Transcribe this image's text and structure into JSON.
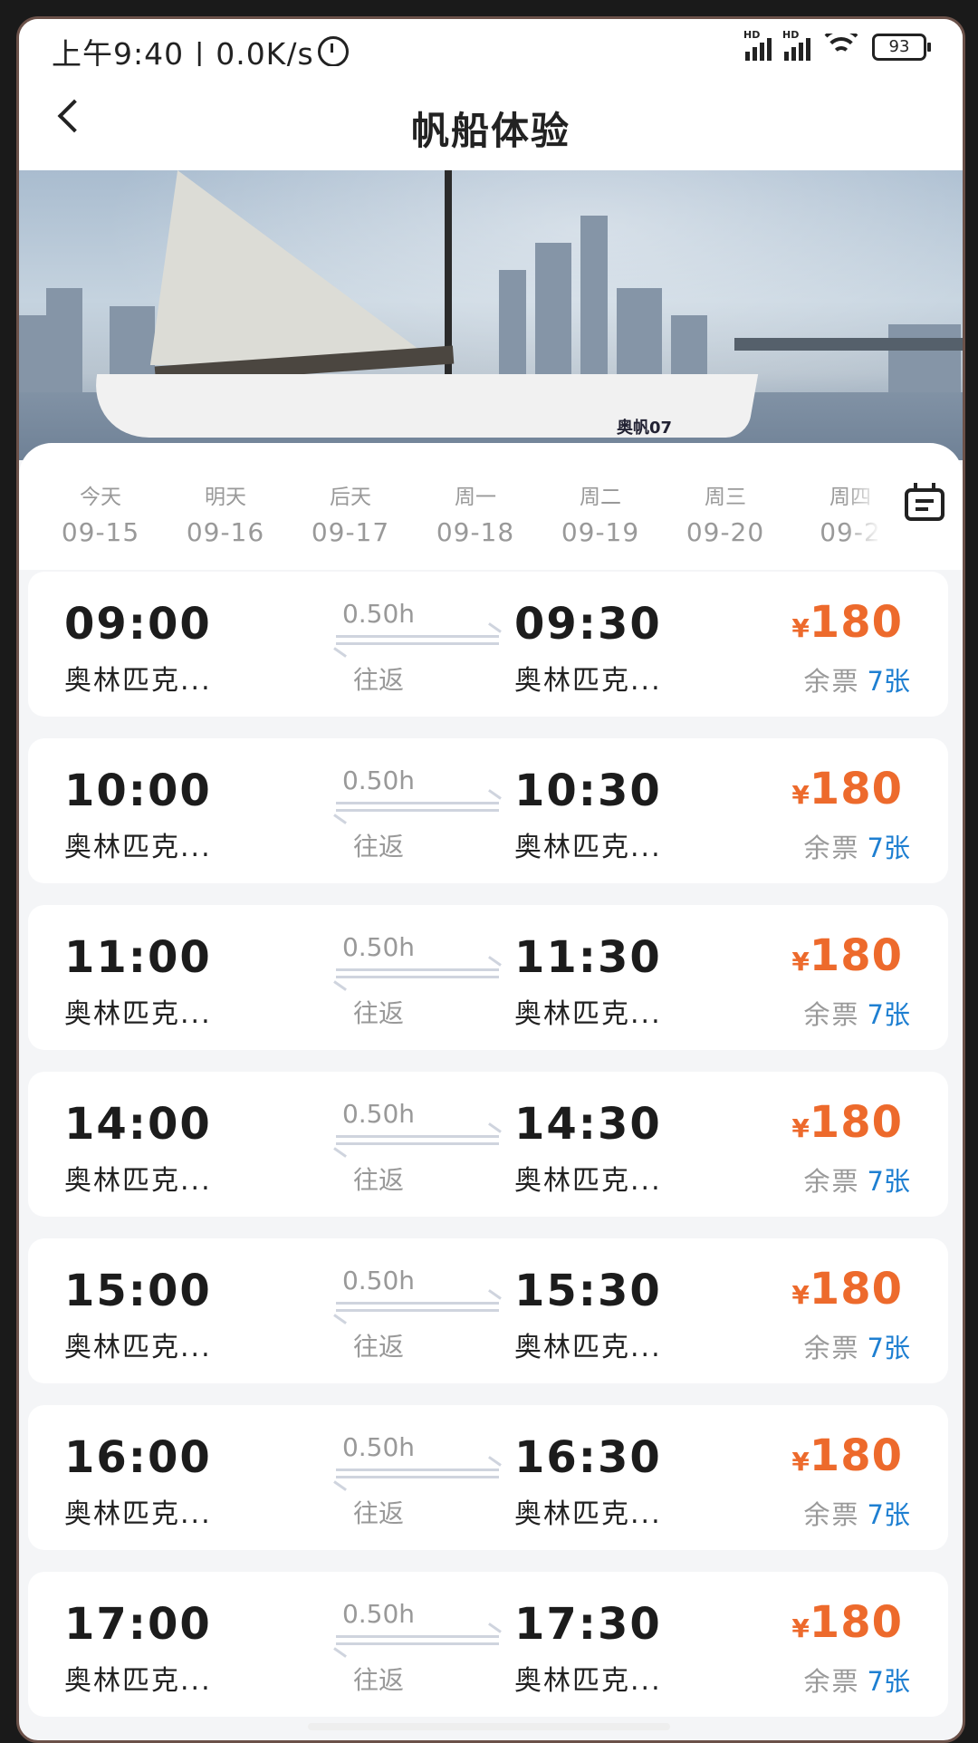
{
  "status_bar": {
    "time_speed": "上午9:40 | 0.0K/s",
    "signal_labels": [
      "HD",
      "HD"
    ],
    "battery": "93"
  },
  "header": {
    "title": "帆船体验"
  },
  "hero": {
    "boat_label": "奥帆07"
  },
  "dates": [
    {
      "weekday": "今天",
      "date": "09-15"
    },
    {
      "weekday": "明天",
      "date": "09-16"
    },
    {
      "weekday": "后天",
      "date": "09-17"
    },
    {
      "weekday": "周一",
      "date": "09-18"
    },
    {
      "weekday": "周二",
      "date": "09-19"
    },
    {
      "weekday": "周三",
      "date": "09-20"
    },
    {
      "weekday": "周四",
      "date": "09-2"
    }
  ],
  "trips": [
    {
      "dep_time": "09:00",
      "dep_place": "奥林匹克...",
      "duration": "0.50h",
      "type": "往返",
      "arr_time": "09:30",
      "arr_place": "奥林匹克...",
      "currency": "¥",
      "price": "180",
      "left_label": "余票",
      "left_count": "7张"
    },
    {
      "dep_time": "10:00",
      "dep_place": "奥林匹克...",
      "duration": "0.50h",
      "type": "往返",
      "arr_time": "10:30",
      "arr_place": "奥林匹克...",
      "currency": "¥",
      "price": "180",
      "left_label": "余票",
      "left_count": "7张"
    },
    {
      "dep_time": "11:00",
      "dep_place": "奥林匹克...",
      "duration": "0.50h",
      "type": "往返",
      "arr_time": "11:30",
      "arr_place": "奥林匹克...",
      "currency": "¥",
      "price": "180",
      "left_label": "余票",
      "left_count": "7张"
    },
    {
      "dep_time": "14:00",
      "dep_place": "奥林匹克...",
      "duration": "0.50h",
      "type": "往返",
      "arr_time": "14:30",
      "arr_place": "奥林匹克...",
      "currency": "¥",
      "price": "180",
      "left_label": "余票",
      "left_count": "7张"
    },
    {
      "dep_time": "15:00",
      "dep_place": "奥林匹克...",
      "duration": "0.50h",
      "type": "往返",
      "arr_time": "15:30",
      "arr_place": "奥林匹克...",
      "currency": "¥",
      "price": "180",
      "left_label": "余票",
      "left_count": "7张"
    },
    {
      "dep_time": "16:00",
      "dep_place": "奥林匹克...",
      "duration": "0.50h",
      "type": "往返",
      "arr_time": "16:30",
      "arr_place": "奥林匹克...",
      "currency": "¥",
      "price": "180",
      "left_label": "余票",
      "left_count": "7张"
    },
    {
      "dep_time": "17:00",
      "dep_place": "奥林匹克...",
      "duration": "0.50h",
      "type": "往返",
      "arr_time": "17:30",
      "arr_place": "奥林匹克...",
      "currency": "¥",
      "price": "180",
      "left_label": "余票",
      "left_count": "7张"
    }
  ],
  "colors": {
    "price": "#ed6a2c",
    "ticket_count": "#1e7fd1",
    "muted_text": "#999999"
  },
  "icons": [
    "alarm-icon",
    "signal-icon",
    "wifi-icon",
    "battery-icon",
    "back-arrow-icon",
    "calendar-icon",
    "round-trip-arrow-icon"
  ]
}
